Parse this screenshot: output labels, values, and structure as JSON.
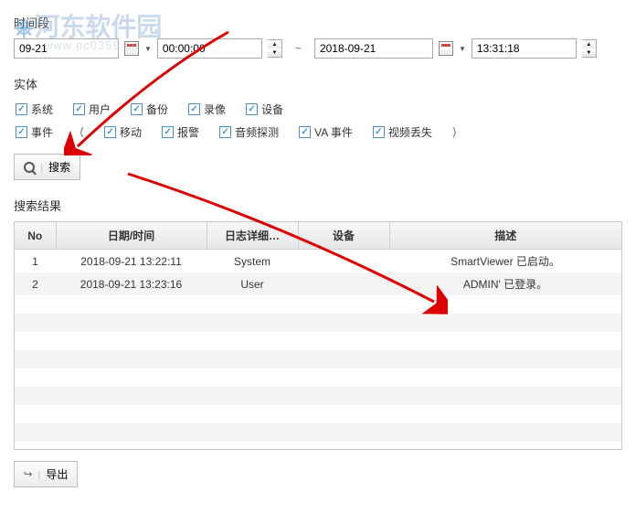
{
  "watermark": {
    "text": "河东软件园",
    "url": "www.pc0359.cn"
  },
  "labels": {
    "time_range": "时间段",
    "entity": "实体",
    "results": "搜索结果"
  },
  "time": {
    "date_from": "09-21",
    "time_from": "00:00:00",
    "separator": "~",
    "date_to": "2018-09-21",
    "time_to": "13:31:18"
  },
  "entities": {
    "row1": [
      {
        "label": "系统"
      },
      {
        "label": "用户"
      },
      {
        "label": "备份"
      },
      {
        "label": "录像"
      },
      {
        "label": "设备"
      }
    ],
    "row2": {
      "lead": "事件",
      "items": [
        {
          "label": "移动"
        },
        {
          "label": "报警"
        },
        {
          "label": "音频探测"
        },
        {
          "label": "VA 事件"
        },
        {
          "label": "视频丢失"
        }
      ]
    }
  },
  "buttons": {
    "search": "搜索",
    "export": "导出"
  },
  "table": {
    "headers": {
      "no": "No",
      "datetime": "日期/时间",
      "detail": "日志详细…",
      "device": "设备",
      "desc": "描述"
    },
    "rows": [
      {
        "no": "1",
        "datetime": "2018-09-21 13:22:11",
        "detail": "System",
        "device": "",
        "desc": "SmartViewer 已启动。"
      },
      {
        "no": "2",
        "datetime": "2018-09-21 13:23:16",
        "detail": "User",
        "device": "",
        "desc": "ADMIN' 已登录。"
      }
    ]
  }
}
